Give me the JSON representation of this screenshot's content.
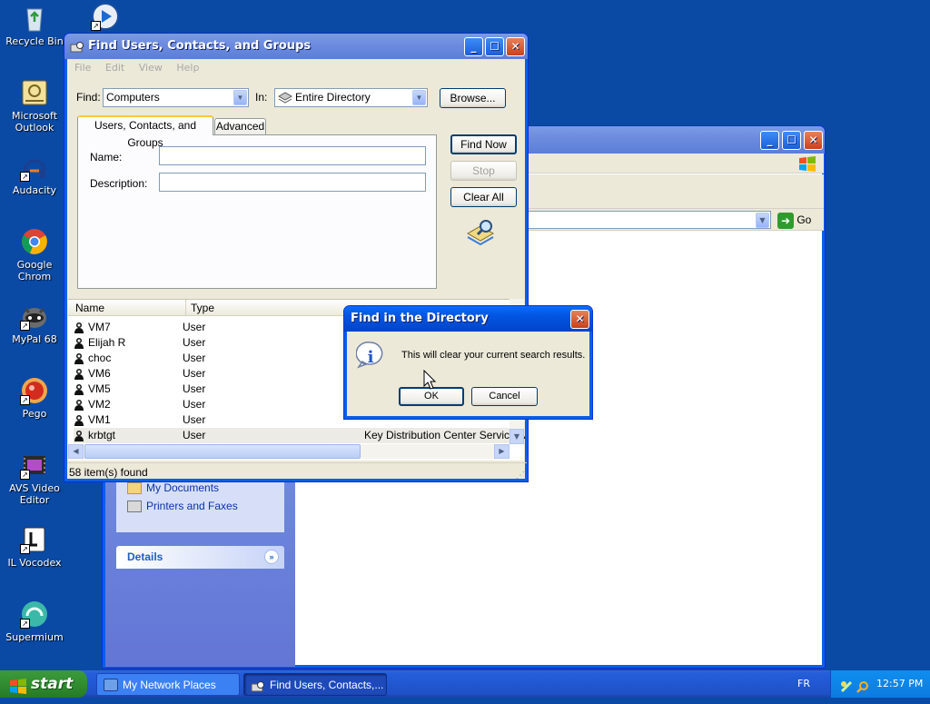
{
  "desktop": {
    "icons": [
      {
        "label": "Recycle Bin"
      },
      {
        "label": "Microsoft Outlook"
      },
      {
        "label": "Audacity"
      },
      {
        "label": "Google Chrom"
      },
      {
        "label": "MyPal 68"
      },
      {
        "label": "Pego"
      },
      {
        "label": "AVS Video Editor"
      },
      {
        "label": "IL Vocodex"
      },
      {
        "label": "Supermium"
      }
    ]
  },
  "bg_window": {
    "go_label": "Go",
    "sidebar_links": [
      "My Documents",
      "Printers and Faxes"
    ],
    "details_label": "Details"
  },
  "find_window": {
    "title": "Find Users, Contacts, and Groups",
    "menu": [
      "File",
      "Edit",
      "View",
      "Help"
    ],
    "find_label": "Find:",
    "find_value": "Computers",
    "in_label": "In:",
    "in_value": "Entire Directory",
    "browse_label": "Browse...",
    "tabs": [
      "Users, Contacts, and Groups",
      "Advanced"
    ],
    "name_label": "Name:",
    "description_label": "Description:",
    "name_value": "",
    "description_value": "",
    "find_now_label": "Find Now",
    "stop_label": "Stop",
    "clear_all_label": "Clear All",
    "columns": [
      "Name",
      "Type"
    ],
    "rows": [
      {
        "name": "VM7",
        "type": "User",
        "desc": ""
      },
      {
        "name": "Elijah R",
        "type": "User",
        "desc": ""
      },
      {
        "name": "choc",
        "type": "User",
        "desc": ""
      },
      {
        "name": "VM6",
        "type": "User",
        "desc": ""
      },
      {
        "name": "VM5",
        "type": "User",
        "desc": ""
      },
      {
        "name": "VM2",
        "type": "User",
        "desc": ""
      },
      {
        "name": "VM1",
        "type": "User",
        "desc": ""
      },
      {
        "name": "krbtgt",
        "type": "User",
        "desc": "Key Distribution Center Service A"
      }
    ],
    "status": "58 item(s) found"
  },
  "dialog": {
    "title": "Find in the Directory",
    "message": "This will clear your current search results.",
    "ok_label": "OK",
    "cancel_label": "Cancel"
  },
  "taskbar": {
    "start_label": "start",
    "items": [
      "My Network Places",
      "Find Users, Contacts,..."
    ],
    "language": "FR",
    "clock": "12:57 PM"
  },
  "colors": {
    "desktop": "#0a4aa5",
    "titlebar_active": "#0255e2",
    "start_green": "#2f8a2f"
  }
}
